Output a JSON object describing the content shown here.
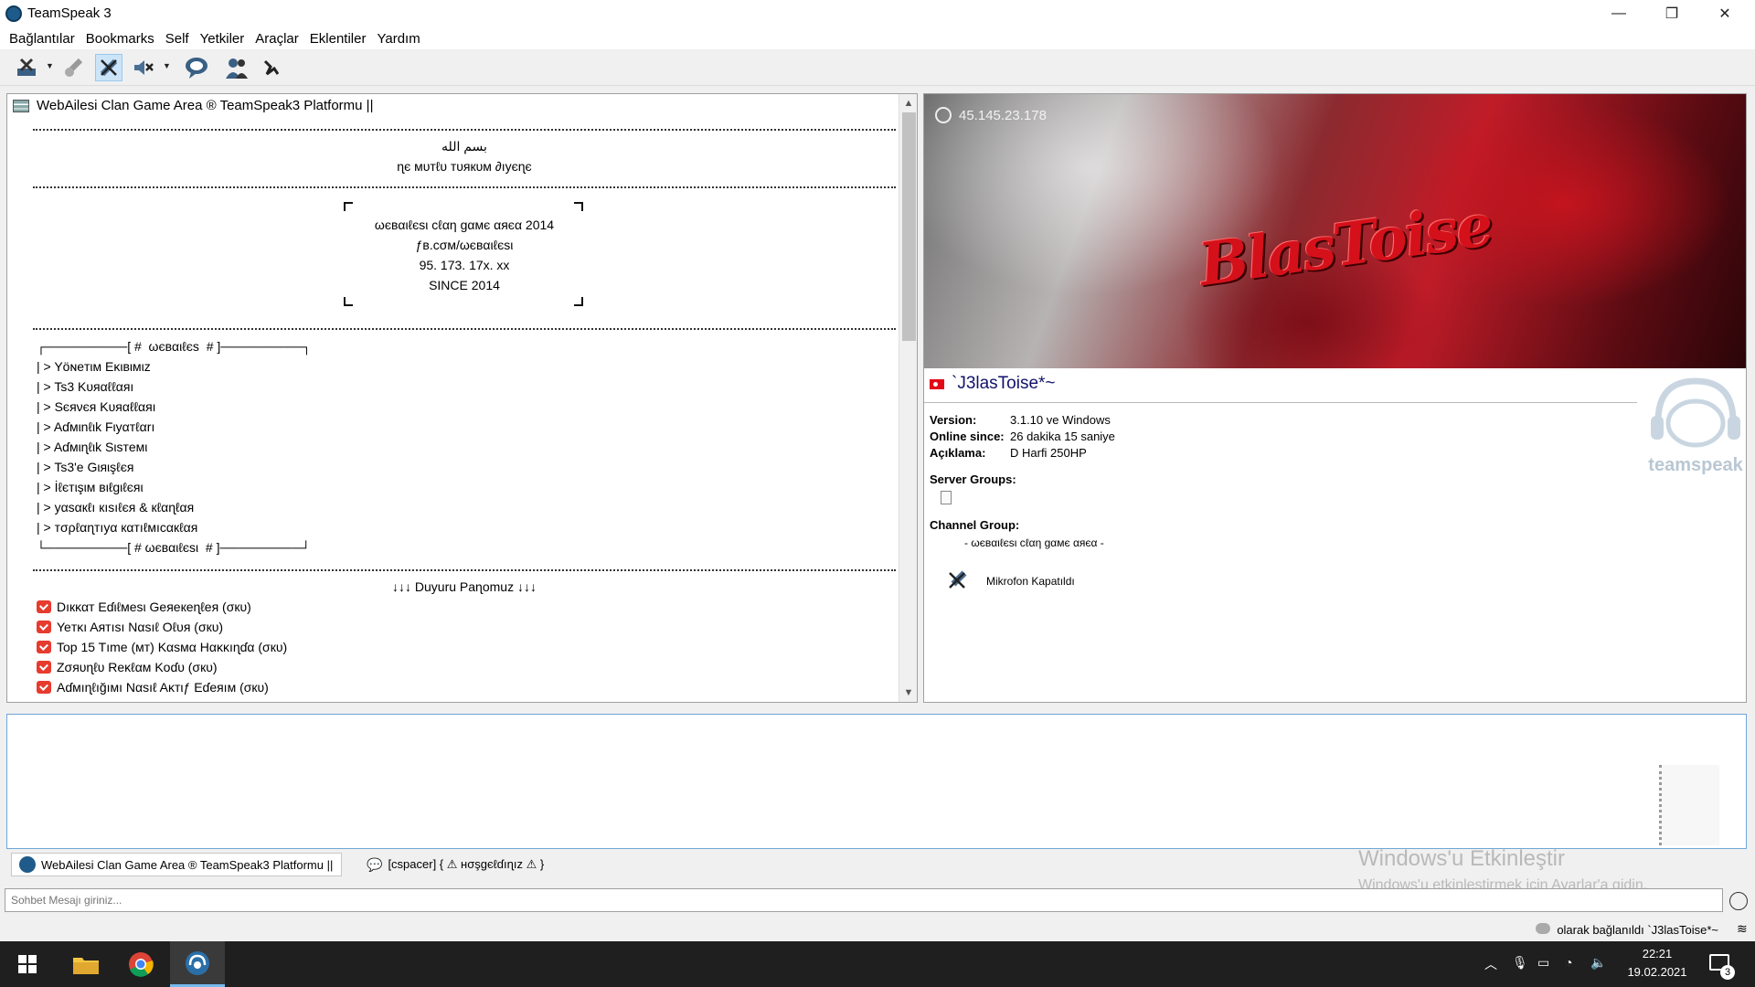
{
  "window": {
    "title": "TeamSpeak 3",
    "minimize": "—",
    "maximize": "❐",
    "close": "✕"
  },
  "menu": [
    "Bağlantılar",
    "Bookmarks",
    "Self",
    "Yetkiler",
    "Araçlar",
    "Eklentiler",
    "Yardım"
  ],
  "server_tree": {
    "header": "WebAilesi Clan Game Area ® TeamSpeak3 Platformu ||",
    "welcome_line1": "بسم الله",
    "welcome_line2": "ɳє мυтℓυ тυякυм ∂ıуєɳє",
    "info_line1": "ωєвαιℓєѕι cℓαη gαмє αяєα 2014",
    "info_line2": "ƒв.cσм/ωєвαιℓєѕι",
    "info_line3": "95. 173. 17x. xx",
    "info_line4": "SINCE 2014",
    "menu_top": "┌─────────[ #  ωєвαιℓєѕ  # ]─────────┐",
    "menu_items": [
      "| > Yöɴeтιм Eĸιвιмιz",
      "| > Ts3 Kυяαℓℓαяı",
      "| > Sєяνєя Kυяαℓℓαяı",
      "| > Aɗмιnℓιk Fιуαтℓαrı",
      "| > Aɗмιɳℓιk Sιѕтeмι",
      "| > Ts3'e Gιяιşℓєя",
      "| > İℓєтιşιм вιℓgιℓєяι",
      "| > уαѕαкℓı кıѕıℓєя & кℓαɳℓαя",
      "| > тσρℓαɳтıуα кαтıℓмıcαкℓαя"
    ],
    "menu_bottom": "└─────────[ # ωєвαιℓєѕι  # ]─────────┘",
    "news_header": "↓↓↓  Duyuru Paɳomuz  ↓↓↓",
    "news_items": [
      "Dıкκαт Eɗιℓмeѕι Geяeкeɳℓeя (σкυ)",
      "Yeтĸı Aятıѕı Nαѕıℓ Oℓυя (σкυ)",
      "Top 15 Tıme (мт) Kαѕмα Hαĸĸıɳɗα (σкυ)",
      "Zσяυɳℓυ Reĸℓαм Koɗυ (σкυ)",
      "Aɗмıɳℓığıмı Nαѕıℓ Aĸтιƒ Eɗeяıм (σкυ)"
    ]
  },
  "client_info": {
    "server_ip": "45.145.23.178",
    "banner_logo": "BlasToise",
    "nickname": "`J3lasToise*~",
    "version_label": "Version:",
    "version_value": "3.1.10 ve Windows",
    "online_label": "Online since:",
    "online_value": "26 dakika 15 saniye",
    "desc_label": "Açıklama:",
    "desc_value": "D Harfi 250HP",
    "server_groups_label": "Server Groups:",
    "channel_group_label": "Channel Group:",
    "channel_group_value": "- ωєвαιℓєѕι cℓαη gαмє αяєα -",
    "mic_status": "Mikrofon Kapatıldı",
    "watermark": "teamspeak"
  },
  "chat": {
    "tab_server": "WebAilesi Clan Game Area ® TeamSpeak3 Platformu ||",
    "tab_channel": "[cspacer] { ⚠ нσşgєℓɗıɳız ⚠ }",
    "input_placeholder": "Sohbet Mesajı giriniz..."
  },
  "activation": {
    "line1": "Windows'u Etkinleştir",
    "line2": "Windows'u etkinleştirmek için Ayarlar'a gidin."
  },
  "status": {
    "connected": "olarak bağlanıldı `J3lasToise*~"
  },
  "taskbar": {
    "time": "22:21",
    "date": "19.02.2021",
    "notifications": "3"
  },
  "colors": {
    "accent_blue": "#1e5b8a",
    "nick_color": "#12126b",
    "news_icon": "#e63b2e",
    "banner_red": "#c01c28"
  }
}
